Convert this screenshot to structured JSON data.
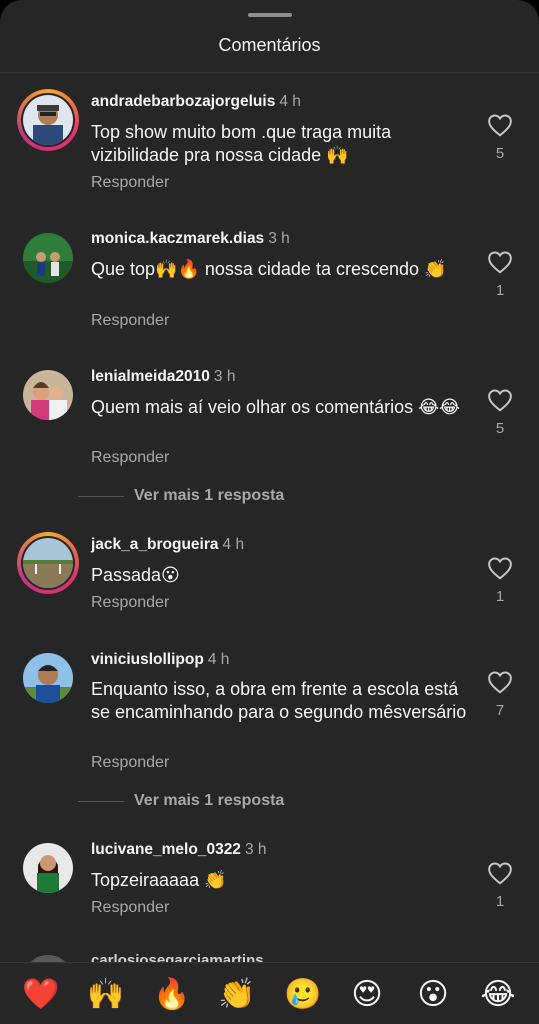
{
  "header": {
    "title": "Comentários"
  },
  "comments": [
    {
      "username": "andradebarbozajorgeluis",
      "time": "4 h",
      "text": "Top show muito bom .que traga muita vizibilidade pra nossa cidade 🙌",
      "reply": "Responder",
      "likes": "5"
    },
    {
      "username": "monica.kaczmarek.dias",
      "time": "3 h",
      "text": "Que top🙌🔥 nossa cidade ta crescendo 👏",
      "reply": "Responder",
      "likes": "1"
    },
    {
      "username": "lenialmeida2010",
      "time": "3 h",
      "text": "Quem mais aí  veio olhar os comentários 😂😂",
      "reply": "Responder",
      "likes": "5",
      "more": "Ver mais 1 resposta"
    },
    {
      "username": "jack_a_brogueira",
      "time": "4 h",
      "text": "Passada😮",
      "reply": "Responder",
      "likes": "1"
    },
    {
      "username": "viniciuslollipop",
      "time": "4 h",
      "text": "Enquanto isso, a obra em frente a escola está se encaminhando para o segundo mêsversário",
      "reply": "Responder",
      "likes": "7",
      "more": "Ver mais 1 resposta"
    },
    {
      "username": "lucivane_melo_0322",
      "time": "3 h",
      "text": "Topzeiraaaaa 👏",
      "reply": "Responder",
      "likes": "1"
    }
  ],
  "partial_comment": {
    "username": "carlosjosegarciamartins"
  },
  "reactions": [
    {
      "emoji": "❤️",
      "icon": "heart-emoji"
    },
    {
      "emoji": "🙌",
      "icon": "raising-hands-emoji"
    },
    {
      "emoji": "🔥",
      "icon": "fire-emoji"
    },
    {
      "emoji": "👏",
      "icon": "clapping-hands-emoji"
    },
    {
      "emoji": "🥲",
      "icon": "smiling-tear-emoji"
    },
    {
      "emoji": "😍",
      "icon": "heart-eyes-emoji"
    },
    {
      "emoji": "😮",
      "icon": "surprised-emoji"
    },
    {
      "emoji": "😂",
      "icon": "laughing-emoji"
    }
  ],
  "colors": {
    "background": "#262626",
    "text": "#f5f5f5",
    "secondary": "#a8a8a8"
  }
}
